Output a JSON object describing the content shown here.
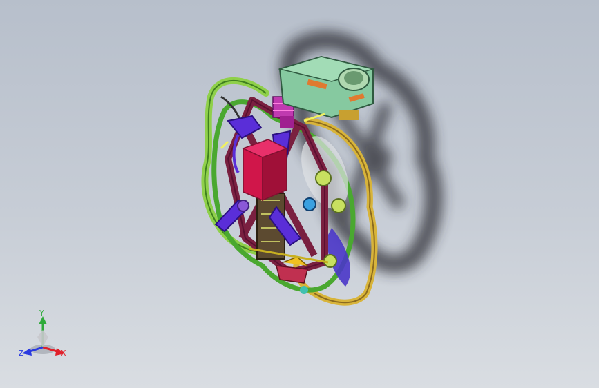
{
  "viewport": {
    "background_top": "#b7bfcb",
    "background_bottom": "#d9dde2",
    "model": {
      "colors": {
        "frame_maroon": "#7a2040",
        "guard_green": "#5fbf3a",
        "guard_yellow": "#d8b43a",
        "battery_red": "#d0164a",
        "blue_arms": "#5a2ed8",
        "camera_mint": "#86c9a0",
        "camera_orange": "#e07a30",
        "motor_lime": "#c8e060",
        "shadow": "#2c2c30"
      }
    },
    "triad": {
      "x_label": "X",
      "y_label": "Y",
      "z_label": "Z",
      "x_color": "#e0202a",
      "y_color": "#2eaa3a",
      "z_color": "#2a3ae0"
    }
  }
}
